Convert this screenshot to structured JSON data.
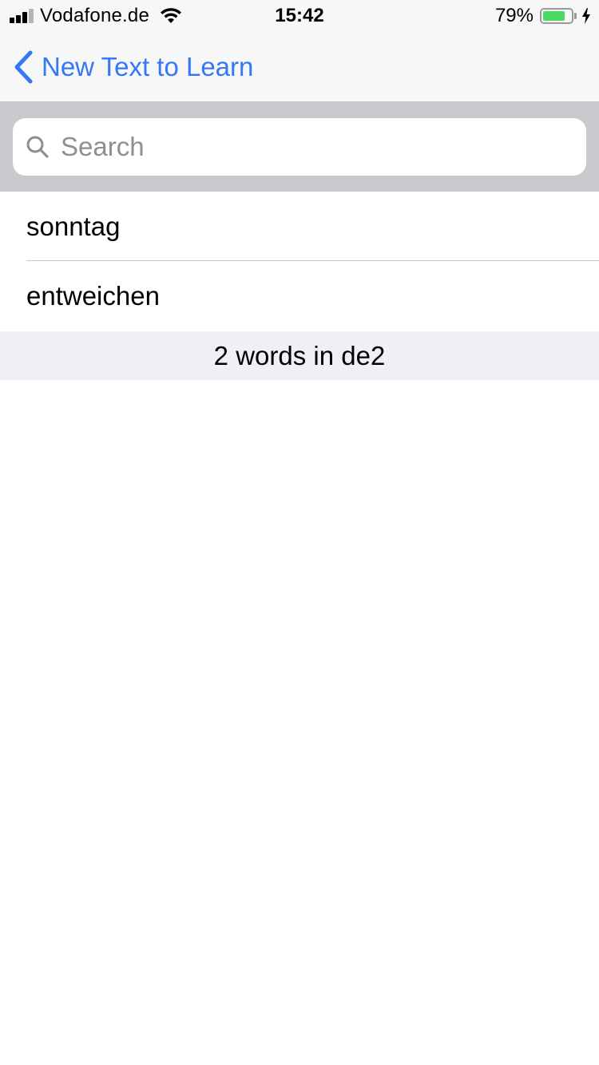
{
  "status_bar": {
    "carrier": "Vodafone.de",
    "time": "15:42",
    "battery_percent": "79%",
    "battery_level": 0.79,
    "signal_bars": 4,
    "signal_bars_active": 3,
    "icons": [
      "signal-icon",
      "wifi-icon",
      "battery-icon",
      "charging-bolt-icon"
    ]
  },
  "nav": {
    "back_label": "New Text to Learn",
    "back_icon": "chevron-left-icon",
    "accent_color": "#3478f6"
  },
  "search": {
    "placeholder": "Search",
    "value": "",
    "icon": "search-icon"
  },
  "words": [
    {
      "label": "sonntag"
    },
    {
      "label": "entweichen"
    }
  ],
  "footer": {
    "summary": "2 words in de2"
  }
}
